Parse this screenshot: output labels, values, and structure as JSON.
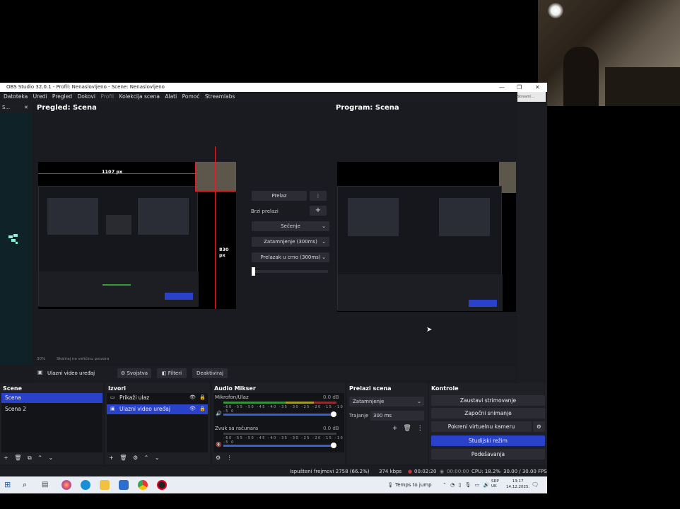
{
  "window": {
    "title": "OBS Studio 32.0.1 - Profil: Nenaslovljeno - Scene: Nenaslovljeno",
    "minimize": "—",
    "maximize": "❐",
    "close": "✕"
  },
  "menu": [
    "Datoteka",
    "Uredi",
    "Pregled",
    "Dokovi",
    "Profil",
    "Kolekcija scena",
    "Alati",
    "Pomoć",
    "Streamlabs"
  ],
  "left_dock": {
    "label": "S...",
    "close": "✕"
  },
  "preview": {
    "title": "Pregled: Scena",
    "width_label": "1107 px",
    "height_label": "830 px",
    "zoom": "30%",
    "scale_text": "Skaliraj na veličinu prozora"
  },
  "program": {
    "title": "Program: Scena"
  },
  "transitions_mid": {
    "prelaz": "Prelaz",
    "quick": "Brzi prelazi",
    "items": [
      "Sečenje",
      "Zatamnjenje (300ms)",
      "Prelazak u crno (300ms)"
    ]
  },
  "source_toolbar": {
    "source": "Ulazni video uređaj",
    "properties": "Svojstva",
    "filters": "Filteri",
    "deactivate": "Deaktiviraj"
  },
  "scenes": {
    "title": "Scene",
    "items": [
      "Scena",
      "Scena 2"
    ],
    "selected": 0
  },
  "sources": {
    "title": "Izvori",
    "items": [
      "Prikaži ulaz",
      "Ulazni video uređaj"
    ],
    "selected": 1
  },
  "mixer": {
    "title": "Audio Mikser",
    "channels": [
      {
        "name": "Mikrofon/Ulaz",
        "db": "0.0 dB"
      },
      {
        "name": "Zvuk sa računara",
        "db": "0.0 dB"
      }
    ],
    "ticks": "-60 -55 -50 -45 -40 -35 -30 -25 -20 -15 -10 -5 0"
  },
  "scene_transitions": {
    "title": "Prelazi scena",
    "selected": "Zatamnjenje",
    "duration_label": "Trajanje",
    "duration": "300 ms"
  },
  "controls": {
    "title": "Kontrole",
    "buttons": [
      "Zaustavi strimovanje",
      "Započni snimanje",
      "Pokreni virtuelnu kameru",
      "Studijski režim",
      "Podešavanja"
    ]
  },
  "status": {
    "dropped": "Ispušteni frejmovi 2758 (66.2%)",
    "bitrate": "374 kbps",
    "live": "00:02:20",
    "rec": "00:00:00",
    "cpu": "CPU: 18.2%",
    "fps": "30.00 / 30.00 FPS"
  },
  "taskbar": {
    "weather": "Temps to jump",
    "lang1": "SRP",
    "lang2": "UK",
    "time": "13:17",
    "date": "14.12.2025."
  },
  "webcam": {
    "label": "Streami..."
  },
  "colors": {
    "accent": "#2a41c9",
    "red": "#e0202a"
  }
}
